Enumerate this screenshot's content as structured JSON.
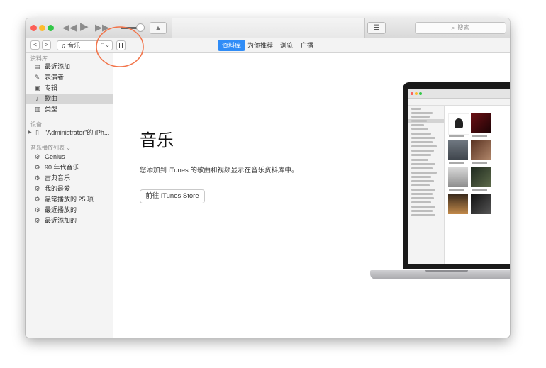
{
  "toolbar": {
    "prev_icon": "rewind-icon",
    "play_icon": "play-icon",
    "next_icon": "fast-forward-icon",
    "airplay_icon": "airplay-icon",
    "list_icon": "list-icon",
    "search_placeholder": "搜索"
  },
  "navbar": {
    "back_glyph": "<",
    "forward_glyph": ">",
    "media_type": "音乐",
    "tabs": [
      {
        "label": "资料库",
        "active": true
      },
      {
        "label": "为你推荐",
        "active": false
      },
      {
        "label": "浏览",
        "active": false
      },
      {
        "label": "广播",
        "active": false
      }
    ]
  },
  "sidebar": {
    "library_header": "资料库",
    "library_items": [
      {
        "label": "最近添加",
        "icon": "grid-icon"
      },
      {
        "label": "表演者",
        "icon": "microphone-icon"
      },
      {
        "label": "专辑",
        "icon": "album-icon"
      },
      {
        "label": "歌曲",
        "icon": "music-note-icon",
        "selected": true
      },
      {
        "label": "类型",
        "icon": "genre-icon"
      }
    ],
    "devices_header": "设备",
    "device_label": "\"Administrator\"的 iPh...",
    "playlists_header": "音乐播放列表 ⌄",
    "playlist_items": [
      {
        "label": "Genius",
        "icon": "gear-icon"
      },
      {
        "label": "90 年代音乐",
        "icon": "gear-icon"
      },
      {
        "label": "古典音乐",
        "icon": "gear-icon"
      },
      {
        "label": "我的最爱",
        "icon": "gear-icon"
      },
      {
        "label": "最常播放的 25 项",
        "icon": "gear-icon"
      },
      {
        "label": "最近播放的",
        "icon": "gear-icon"
      },
      {
        "label": "最近添加的",
        "icon": "gear-icon"
      }
    ]
  },
  "main": {
    "title": "音乐",
    "description": "您添加到 iTunes 的歌曲和视频显示在音乐资料库中。",
    "store_button": "前往 iTunes Store"
  }
}
